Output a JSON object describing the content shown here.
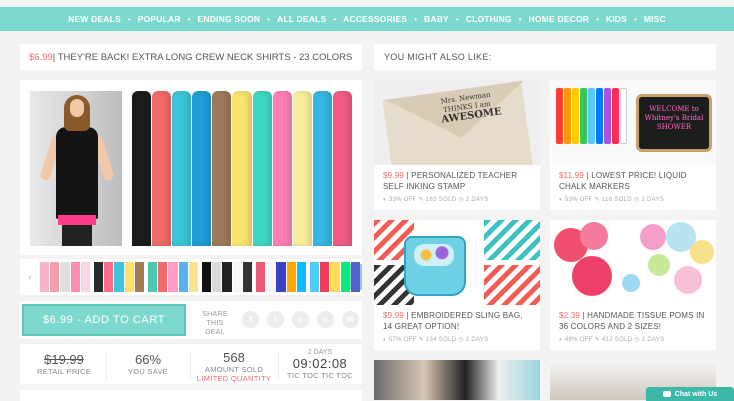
{
  "nav": {
    "items": [
      "NEW DEALS",
      "POPULAR",
      "ENDING SOON",
      "ALL DEALS",
      "ACCESSORIES",
      "BABY",
      "CLOTHING",
      "HOME DECOR",
      "KIDS",
      "MISC"
    ],
    "separator": "•"
  },
  "deal": {
    "price": "$6.99",
    "title": " | THEY'RE BACK! EXTRA LONG CREW NECK SHIRTS - 23 COLORS",
    "shirt_colors": [
      "#1c1c1c",
      "#f26a6a",
      "#3ac5d8",
      "#1e9fd6",
      "#a0795a",
      "#f7e46d",
      "#3ed8c3",
      "#ff7fb4",
      "#f7ef9a",
      "#37b6e3",
      "#f05c85"
    ],
    "thumbnails": [
      [
        "#f4b6c8",
        "#f2a0b0",
        "#e0e0e0",
        "#ff8fb1",
        "#f7d7e0"
      ],
      [
        "#2a2a2a",
        "#ff6b8a",
        "#3fc6da",
        "#ffe066",
        "#a77a56"
      ],
      [
        "#48c9b0",
        "#f26a6a",
        "#ff9ec7",
        "#5ab1ef",
        "#f6e58d"
      ],
      [
        "#111111",
        "#d9d9d9",
        "#222222",
        "#f5f5f5",
        "#333333"
      ],
      [
        "#ef5777",
        "#f5f6fa",
        "#3c40c6",
        "#ffa801",
        "#0fbcf9"
      ],
      [
        "#4bcffa",
        "#f53b57",
        "#ffdd59",
        "#0be881",
        "#575fcf"
      ]
    ],
    "arrow_left": "‹",
    "arrow_right": "›",
    "cart_button": "$6.99 - ADD TO CART",
    "share_label_1": "SHARE",
    "share_label_2": "THIS DEAL",
    "share_icons": [
      "f",
      "t",
      "p",
      "c",
      "✉"
    ]
  },
  "stats": {
    "retail_price": "$19.99",
    "retail_label": "RETAIL PRICE",
    "savings": "66%",
    "savings_label": "YOU SAVE",
    "amount_sold": "568",
    "amount_sold_label": "AMOUNT SOLD",
    "limited_label": "LIMITED QUANTITY",
    "timer_days": "2 DAYS",
    "timer": "09:02:08",
    "timer_label": "TIC TOC TIC TOC"
  },
  "also": {
    "heading": "YOU MIGHT ALSO LIKE:",
    "cards": [
      {
        "price": "$9.99",
        "title": " | PERSONALIZED TEACHER SELF INKING STAMP",
        "meta": "◐ 33% OFF   ✎ 163 SOLD   ◷ 2 DAYS",
        "stamp_line1": "Mrs. Newman",
        "stamp_line2": "THINKS I am",
        "stamp_line3": "AWESOME"
      },
      {
        "price": "$11.99",
        "title": " | LOWEST PRICE! LIQUID CHALK MARKERS",
        "meta": "◐ 53% OFF   ✎ 116 SOLD   ◷ 2 DAYS",
        "sign_text": "WELCOME to Whitney's Bridal SHOWER"
      },
      {
        "price": "$9.99",
        "title": " | EMBROIDERED SLING BAG, 14 GREAT OPTION!",
        "meta": "◐ 57% OFF   ✎ 134 SOLD   ◷ 2 DAYS"
      },
      {
        "price": "$2.39",
        "title": " | HANDMADE TISSUE POMS IN 36 COLORS AND 2 SIZES!",
        "meta": "◐ 48% OFF   ✎ 412 SOLD   ◷ 2 DAYS"
      }
    ]
  },
  "chat": {
    "label": "Chat with Us"
  }
}
